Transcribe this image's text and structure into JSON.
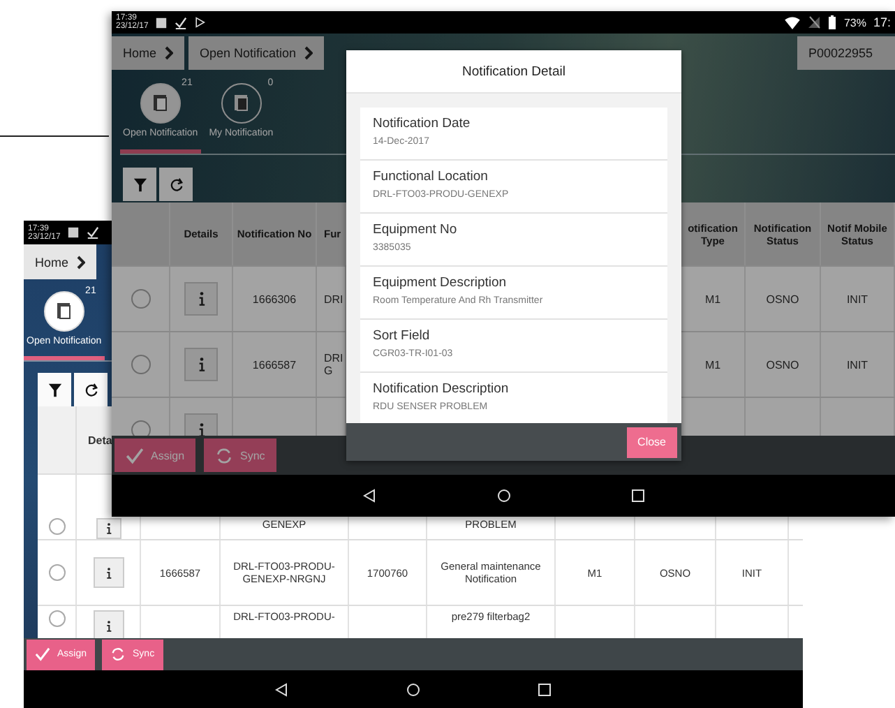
{
  "back_screen": {
    "status": {
      "time": "17:39",
      "date": "23/12/17"
    },
    "breadcrumb": [
      "Home"
    ],
    "tabs": [
      {
        "label": "Open Notification",
        "count": "21",
        "selected": true
      }
    ],
    "table": {
      "columns": {
        "details": "Deta"
      },
      "rows": [
        {
          "selected": false,
          "functional_location": "GENEXP",
          "description": "PROBLEM"
        },
        {
          "selected": false,
          "notification_no": "1666587",
          "functional_location": "DRL-FTO03-PRODU-GENEXP-NRGNJ",
          "equipment_no": "1700760",
          "description": "General maintenance Notification",
          "type": "M1",
          "status": "OSNO",
          "mobile_status": "INIT"
        },
        {
          "selected": false,
          "functional_location": "DRL-FTO03-PRODU-",
          "description": "pre279 filterbag2"
        }
      ]
    },
    "actions": [
      "Assign",
      "Sync"
    ]
  },
  "front_screen": {
    "status": {
      "time": "17:39",
      "date": "23/12/17",
      "battery": "73%",
      "clock": "17:"
    },
    "breadcrumb": [
      "Home",
      "Open Notification"
    ],
    "user": "P00022955",
    "tabs": [
      {
        "label": "Open Notification",
        "count": "21",
        "selected": true
      },
      {
        "label": "My Notification",
        "count": "0",
        "selected": false
      }
    ],
    "table": {
      "columns": {
        "details": "Details",
        "notification_no": "Notification No",
        "column_4": "Fur",
        "type": "otification Type",
        "status": "Notification Status",
        "mobile_status": "Notif Mobile Status"
      },
      "rows": [
        {
          "selected": false,
          "notification_no": "1666306",
          "column_4": "DRI",
          "type": "M1",
          "status": "OSNO",
          "mobile_status": "INIT"
        },
        {
          "selected": false,
          "notification_no": "1666587",
          "column_4": "DRI G",
          "type": "M1",
          "status": "OSNO",
          "mobile_status": "INIT"
        },
        {
          "selected": false
        }
      ]
    },
    "actions": [
      "Assign",
      "Sync"
    ],
    "modal": {
      "title": "Notification Detail",
      "fields": [
        {
          "label": "Notification Date",
          "value": "14-Dec-2017"
        },
        {
          "label": "Functional Location",
          "value": "DRL-FTO03-PRODU-GENEXP"
        },
        {
          "label": "Equipment No",
          "value": "3385035"
        },
        {
          "label": "Equipment Description",
          "value": "Room Temperature And Rh Transmitter"
        },
        {
          "label": "Sort Field",
          "value": "CGR03-TR-I01-03"
        },
        {
          "label": "Notification Description",
          "value": "RDU SENSER PROBLEM"
        }
      ],
      "close": "Close"
    }
  }
}
